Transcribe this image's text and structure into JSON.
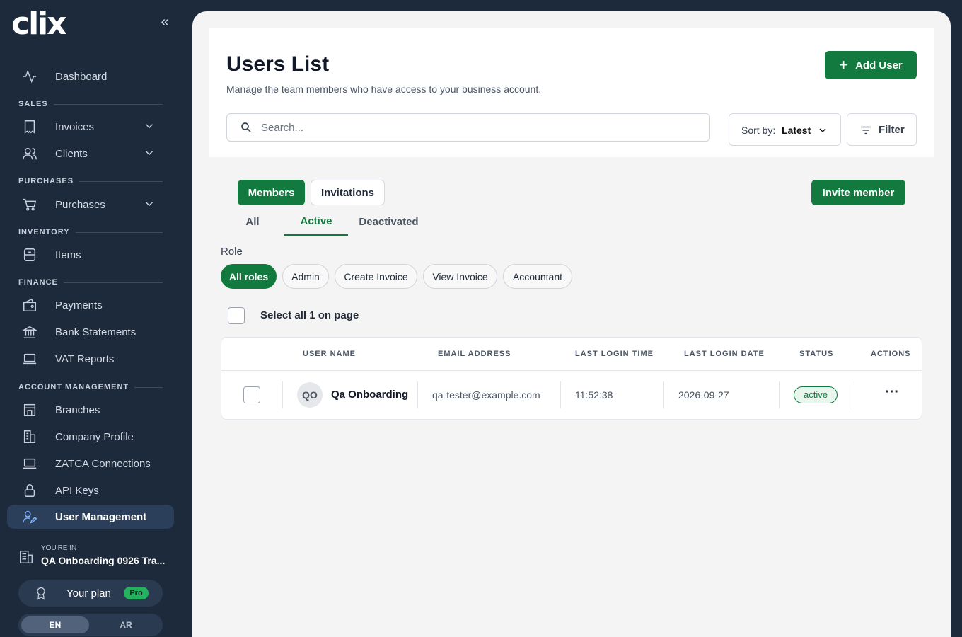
{
  "app": {
    "logo": "CIIX"
  },
  "sidebar": {
    "collapse_glyph": "«",
    "items": [
      {
        "label": "Dashboard",
        "icon": "activity-icon"
      },
      {
        "label": "Invoices",
        "icon": "receipt-icon"
      },
      {
        "label": "Clients",
        "icon": "users-icon"
      },
      {
        "label": "Purchases",
        "icon": "cart-icon"
      },
      {
        "label": "Items",
        "icon": "box-icon"
      },
      {
        "label": "Payments",
        "icon": "wallet-icon"
      },
      {
        "label": "Bank Statements",
        "icon": "bank-icon"
      },
      {
        "label": "VAT Reports",
        "icon": "laptop-icon"
      },
      {
        "label": "Branches",
        "icon": "store-icon"
      },
      {
        "label": "Company Profile",
        "icon": "building-icon"
      },
      {
        "label": "ZATCA Connections",
        "icon": "laptop-icon"
      },
      {
        "label": "API Keys",
        "icon": "lock-icon"
      },
      {
        "label": "User Management",
        "icon": "user-edit-icon"
      }
    ],
    "sections": [
      "SALES",
      "PURCHASES",
      "INVENTORY",
      "FINANCE",
      "ACCOUNT MANAGEMENT"
    ],
    "youre_in_label": "YOU'RE IN",
    "business_name": "QA Onboarding 0926 Tra...",
    "plan_label": "Your plan",
    "plan_badge": "Pro",
    "lang_en": "EN",
    "lang_ar": "AR"
  },
  "header": {
    "title": "Users List",
    "subtitle": "Manage the team members who have access to your business account.",
    "add_user_label": "Add User",
    "search_placeholder": "Search...",
    "sort_prefix": "Sort by:",
    "sort_value": "Latest",
    "filter_label": "Filter"
  },
  "segments": {
    "members": "Members",
    "invitations": "Invitations",
    "invite_label": "Invite member"
  },
  "tabs": [
    "All",
    "Active",
    "Deactivated"
  ],
  "roles": {
    "label": "Role",
    "chips": [
      "All roles",
      "Admin",
      "Create Invoice",
      "View Invoice",
      "Accountant"
    ]
  },
  "select_all_label": "Select all 1 on page",
  "table": {
    "columns": [
      "USER NAME",
      "EMAIL ADDRESS",
      "LAST LOGIN TIME",
      "LAST LOGIN DATE",
      "STATUS",
      "ACTIONS"
    ],
    "rows": [
      {
        "initials": "QO",
        "name": "Qa Onboarding",
        "email": "qa-tester@example.com",
        "time": "11:52:38",
        "date": "2026-09-27",
        "status": "active",
        "actions_glyph": "···"
      }
    ]
  },
  "colors": {
    "brand_green": "#127a3e",
    "sidebar_bg": "#1c2a3c",
    "active_icon": "#7fb4ff",
    "pro_badge": "#22b35e"
  }
}
